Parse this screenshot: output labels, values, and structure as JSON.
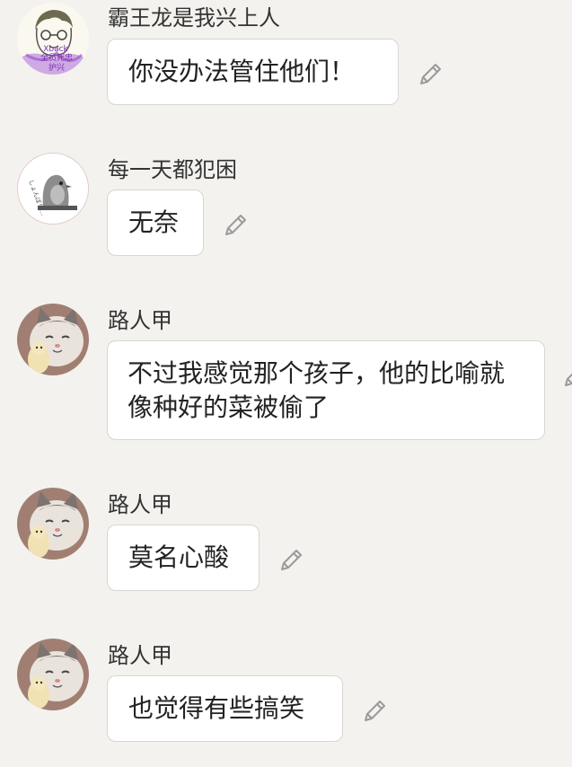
{
  "messages": [
    {
      "sender": "霸王龙是我兴上人",
      "text": "你没办法管住他们！",
      "avatar": "sketch-avatar",
      "avatar_text": [
        "Xback",
        "全员死忠",
        "护兴"
      ]
    },
    {
      "sender": "每一天都犯困",
      "text": "无奈",
      "avatar": "penguin-avatar"
    },
    {
      "sender": "路人甲",
      "text": "不过我感觉那个孩子，他的比喻就像种好的菜被偷了",
      "avatar": "kitten-avatar"
    },
    {
      "sender": "路人甲",
      "text": "莫名心酸",
      "avatar": "kitten-avatar"
    },
    {
      "sender": "路人甲",
      "text": "也觉得有些搞笑",
      "avatar": "kitten-avatar"
    }
  ],
  "icons": {
    "edit": "pencil-edit-icon"
  },
  "colors": {
    "background": "#f3f2ee",
    "bubble": "#ffffff",
    "bubble_border": "#d8d6d0",
    "icon": "#9a9a9a"
  }
}
